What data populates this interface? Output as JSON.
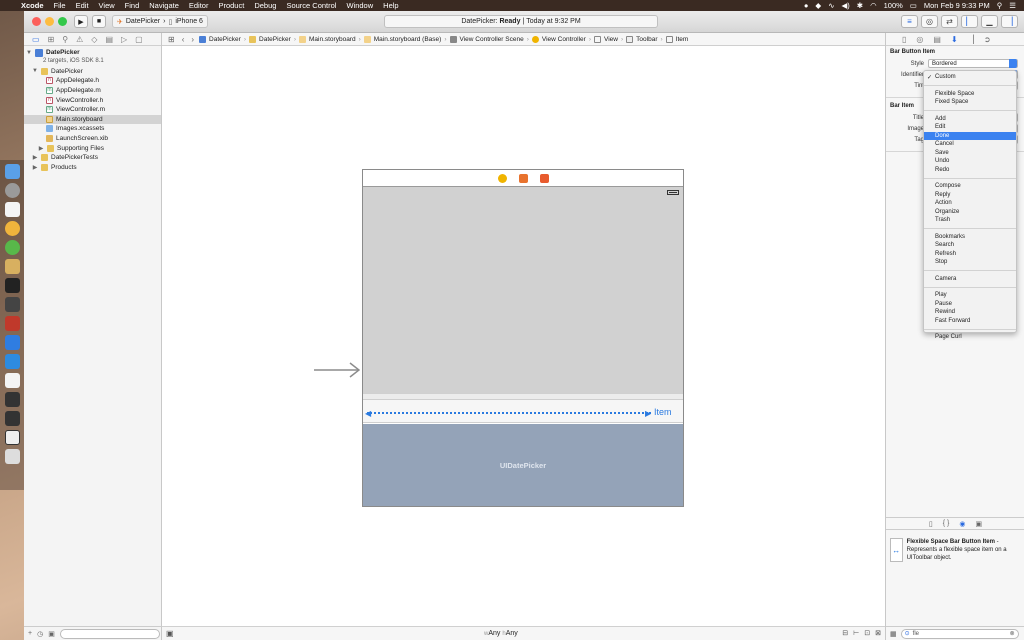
{
  "menubar": {
    "app": "Xcode",
    "items": [
      "File",
      "Edit",
      "View",
      "Find",
      "Navigate",
      "Editor",
      "Product",
      "Debug",
      "Source Control",
      "Window",
      "Help"
    ],
    "battery": "100%",
    "clock": "Mon Feb 9  9:33 PM"
  },
  "toolbar": {
    "scheme": "DatePicker",
    "device": "iPhone 6",
    "activity_app": "DatePicker:",
    "activity_status": "Ready",
    "activity_time": "Today at 9:32 PM"
  },
  "navigator": {
    "project_name": "DatePicker",
    "project_sub": "2 targets, iOS SDK 8.1",
    "files": [
      {
        "label": "DatePicker",
        "kind": "folder",
        "indent": 1,
        "open": true
      },
      {
        "label": "AppDelegate.h",
        "kind": "h",
        "indent": 2
      },
      {
        "label": "AppDelegate.m",
        "kind": "m",
        "indent": 2
      },
      {
        "label": "ViewController.h",
        "kind": "h",
        "indent": 2
      },
      {
        "label": "ViewController.m",
        "kind": "m",
        "indent": 2
      },
      {
        "label": "Main.storyboard",
        "kind": "sb",
        "indent": 2,
        "selected": true
      },
      {
        "label": "Images.xcassets",
        "kind": "xc",
        "indent": 2
      },
      {
        "label": "LaunchScreen.xib",
        "kind": "xib",
        "indent": 2
      },
      {
        "label": "Supporting Files",
        "kind": "folder",
        "indent": 2,
        "closed": true
      },
      {
        "label": "DatePickerTests",
        "kind": "folder",
        "indent": 1,
        "closed": true
      },
      {
        "label": "Products",
        "kind": "folder",
        "indent": 1,
        "closed": true
      }
    ]
  },
  "jumpbar": [
    "DatePicker",
    "DatePicker",
    "Main.storyboard",
    "Main.storyboard (Base)",
    "View Controller Scene",
    "View Controller",
    "View",
    "Toolbar",
    "Item"
  ],
  "canvas": {
    "toolbar_item_label": "Item",
    "picker_label": "UIDatePicker"
  },
  "editor_footer": {
    "w_prefix": "w",
    "width_class": "Any",
    "h_prefix": "h",
    "height_class": "Any"
  },
  "inspector": {
    "bar_button_section": "Bar Button Item",
    "style_label": "Style",
    "style_value": "Bordered",
    "identifier_label": "Identifier",
    "tint_label": "Tint",
    "bar_item_section": "Bar Item",
    "title_label": "Title",
    "image_label": "Image",
    "tag_label": "Tag",
    "library_item_title": "Flexible Space Bar Button Item",
    "library_item_desc": "- Represents a flexible space item on a UIToolbar object.",
    "search_value": "fle"
  },
  "identifier_menu": {
    "groups": [
      [
        "Custom"
      ],
      [
        "Flexible Space",
        "Fixed Space"
      ],
      [
        "Add",
        "Edit",
        "Done",
        "Cancel",
        "Save",
        "Undo",
        "Redo"
      ],
      [
        "Compose",
        "Reply",
        "Action",
        "Organize",
        "Trash"
      ],
      [
        "Bookmarks",
        "Search",
        "Refresh",
        "Stop"
      ],
      [
        "Camera"
      ],
      [
        "Play",
        "Pause",
        "Rewind",
        "Fast Forward"
      ],
      [
        "Page Curl"
      ]
    ],
    "checked": "Custom",
    "highlighted": "Done"
  },
  "colors": {
    "accent": "#3b82f0",
    "picker": "#94a3b8",
    "view_bg": "#d1d1d1"
  }
}
